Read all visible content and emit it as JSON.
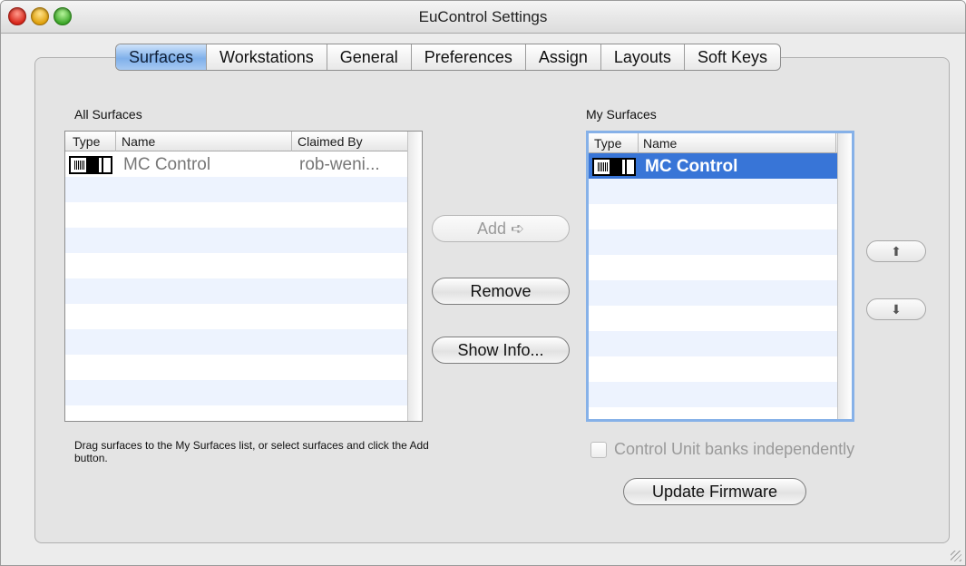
{
  "window": {
    "title": "EuControl Settings"
  },
  "tabs": [
    {
      "label": "Surfaces",
      "active": true
    },
    {
      "label": "Workstations",
      "active": false
    },
    {
      "label": "General",
      "active": false
    },
    {
      "label": "Preferences",
      "active": false
    },
    {
      "label": "Assign",
      "active": false
    },
    {
      "label": "Layouts",
      "active": false
    },
    {
      "label": "Soft Keys",
      "active": false
    }
  ],
  "all_surfaces": {
    "label": "All Surfaces",
    "columns": [
      "Type",
      "Name",
      "Claimed By"
    ],
    "rows": [
      {
        "type_icon": "surface-device-icon",
        "name": "MC Control",
        "claimed_by": "rob-weni..."
      }
    ]
  },
  "my_surfaces": {
    "label": "My Surfaces",
    "columns": [
      "Type",
      "Name"
    ],
    "rows": [
      {
        "type_icon": "surface-device-icon",
        "name": "MC Control",
        "selected": true
      }
    ]
  },
  "buttons": {
    "add": "Add ➪",
    "remove": "Remove",
    "show_info": "Show Info...",
    "move_up": "⬆",
    "move_down": "⬇",
    "update_firmware": "Update Firmware"
  },
  "hint": "Drag surfaces to the My Surfaces list, or select surfaces and click the Add button.",
  "checkbox": {
    "label": "Control Unit banks independently",
    "checked": false,
    "enabled": false
  },
  "colors": {
    "selection": "#3875d7",
    "active_tab": "#7fb0ea",
    "row_stripe": "#edf3fe"
  }
}
